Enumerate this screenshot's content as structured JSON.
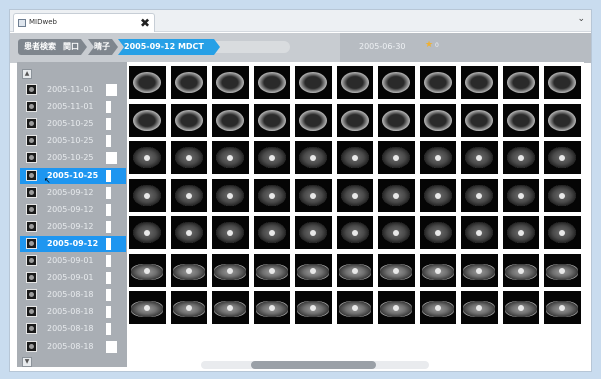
{
  "window": {
    "tab_label": "MIDweb"
  },
  "breadcrumb": {
    "items": [
      "患者検索",
      "関口",
      "晴子",
      "2005-09-12 MDCT"
    ],
    "right_date": "2005-06-30",
    "right_count": "0"
  },
  "sidebar": {
    "series": [
      {
        "date": "2005-11-01",
        "flag": "wide",
        "selected": false
      },
      {
        "date": "2005-11-01",
        "flag": "thin",
        "selected": false
      },
      {
        "date": "2005-10-25",
        "flag": "thin",
        "selected": false
      },
      {
        "date": "2005-10-25",
        "flag": "thin",
        "selected": false
      },
      {
        "date": "2005-10-25",
        "flag": "wide",
        "selected": false
      },
      {
        "date": "2005-10-25",
        "flag": "thin",
        "selected": true
      },
      {
        "date": "2005-09-12",
        "flag": "thin",
        "selected": false
      },
      {
        "date": "2005-09-12",
        "flag": "thin",
        "selected": false
      },
      {
        "date": "2005-09-12",
        "flag": "thin",
        "selected": false
      },
      {
        "date": "2005-09-12",
        "flag": "thin",
        "selected": true
      },
      {
        "date": "2005-09-01",
        "flag": "thin",
        "selected": false
      },
      {
        "date": "2005-09-01",
        "flag": "thin",
        "selected": false
      },
      {
        "date": "2005-08-18",
        "flag": "thin",
        "selected": false
      },
      {
        "date": "2005-08-18",
        "flag": "thin",
        "selected": false
      },
      {
        "date": "2005-08-18",
        "flag": "thin",
        "selected": false
      },
      {
        "date": "2005-08-18",
        "flag": "wide",
        "selected": false
      }
    ]
  },
  "viewer": {
    "columns": 11,
    "rows": 7
  },
  "colors": {
    "accent": "#1e96f0",
    "breadcrumb_blue": "#27a0e6",
    "breadcrumb_gray": "#7f868e",
    "sidebar_bg": "#a9aeb4"
  },
  "icons": {
    "tab": "app-icon",
    "close": "close-icon",
    "menu": "chevron-down-icon",
    "scroll_up": "arrow-up-icon",
    "scroll_down": "arrow-down-icon"
  }
}
